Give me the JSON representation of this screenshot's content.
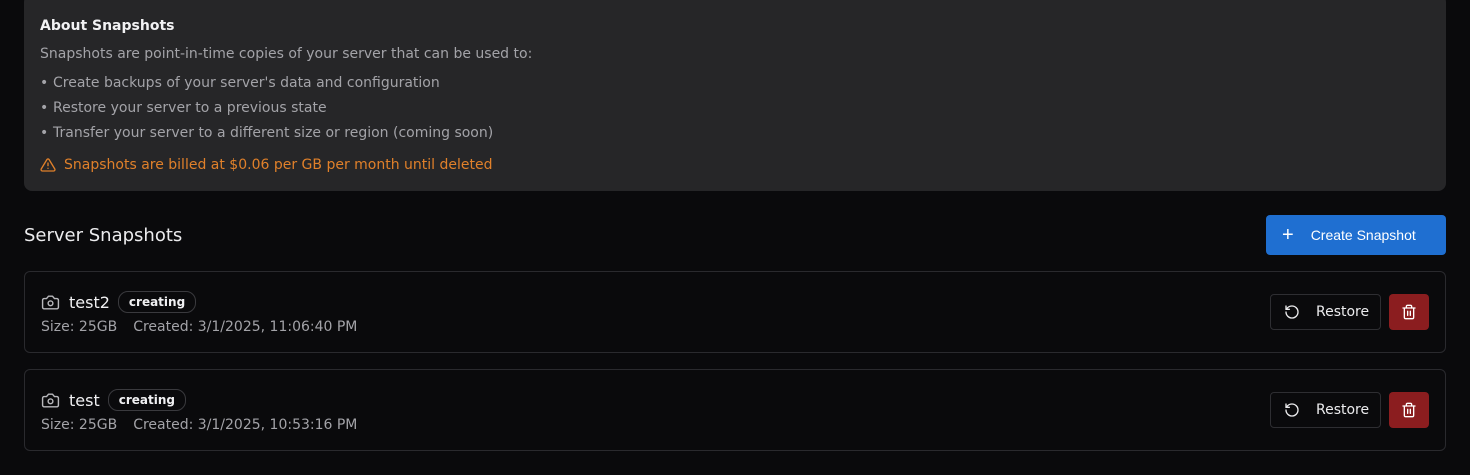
{
  "about": {
    "title": "About Snapshots",
    "description": "Snapshots are point-in-time copies of your server that can be used to:",
    "bullets": [
      "Create backups of your server's data and configuration",
      "Restore your server to a previous state",
      "Transfer your server to a different size or region (coming soon)"
    ],
    "bullet_glyph": "•",
    "warning": "Snapshots are billed at $0.06 per GB per month until deleted",
    "warning_icon": "warning-triangle-icon",
    "warning_color": "#e0802a"
  },
  "section": {
    "title": "Server Snapshots",
    "create_button_label": "Create Snapshot",
    "create_button_icon": "+",
    "accent": "#1f6fd1"
  },
  "snapshots": [
    {
      "name": "test2",
      "status": "creating",
      "size": "Size: 25GB",
      "created": "Created: 3/1/2025, 11:06:40 PM",
      "restore_label": "Restore"
    },
    {
      "name": "test",
      "status": "creating",
      "size": "Size: 25GB",
      "created": "Created: 3/1/2025, 10:53:16 PM",
      "restore_label": "Restore"
    }
  ],
  "colors": {
    "danger": "#8b1d1f",
    "panel": "#262628",
    "background": "#0a0a0c"
  }
}
